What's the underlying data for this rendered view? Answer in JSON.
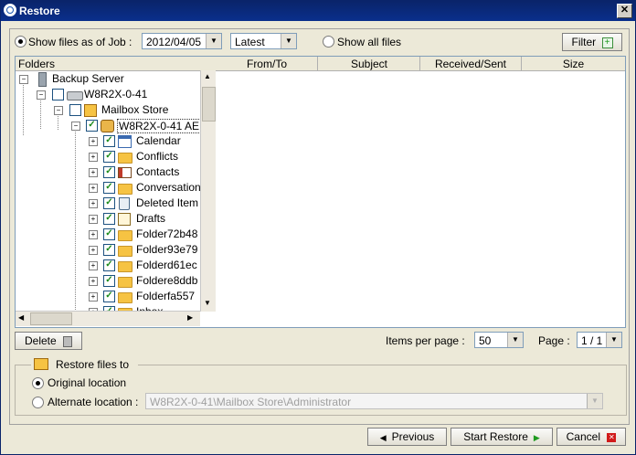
{
  "window": {
    "title": "Restore"
  },
  "filter_bar": {
    "show_as_of_job_label": "Show files as of Job :",
    "job_date": "2012/04/05",
    "job_version": "Latest",
    "show_all_label": "Show all files",
    "filter_button": "Filter"
  },
  "tree": {
    "header": "Folders",
    "nodes": [
      {
        "label": "Backup Server"
      },
      {
        "label": "W8R2X-0-41"
      },
      {
        "label": "Mailbox Store"
      },
      {
        "label": "W8R2X-0-41 AE"
      },
      {
        "label": "Calendar"
      },
      {
        "label": "Conflicts"
      },
      {
        "label": "Contacts"
      },
      {
        "label": "Conversation"
      },
      {
        "label": "Deleted Item"
      },
      {
        "label": "Drafts"
      },
      {
        "label": "Folder72b48"
      },
      {
        "label": "Folder93e79"
      },
      {
        "label": "Folderd61ec"
      },
      {
        "label": "Foldere8ddb"
      },
      {
        "label": "Folderfa557"
      },
      {
        "label": "Inbox"
      }
    ]
  },
  "table": {
    "columns": [
      "From/To",
      "Subject",
      "Received/Sent",
      "Size"
    ]
  },
  "pager": {
    "delete_button": "Delete",
    "items_per_page_label": "Items per page :",
    "items_per_page": "50",
    "page_label": "Page :",
    "page_value": "1 / 1"
  },
  "restore_to": {
    "section_label": "Restore files to",
    "original_label": "Original location",
    "alternate_label": "Alternate location :",
    "alternate_path": "W8R2X-0-41\\Mailbox Store\\Administrator"
  },
  "footer": {
    "previous_button": "Previous",
    "start_button": "Start Restore",
    "cancel_button": "Cancel"
  },
  "colors": {
    "title_bar": "#0a246a",
    "check": "#1a8a1a",
    "close_red": "#d11b1b",
    "start_green": "#1f9a1f"
  }
}
